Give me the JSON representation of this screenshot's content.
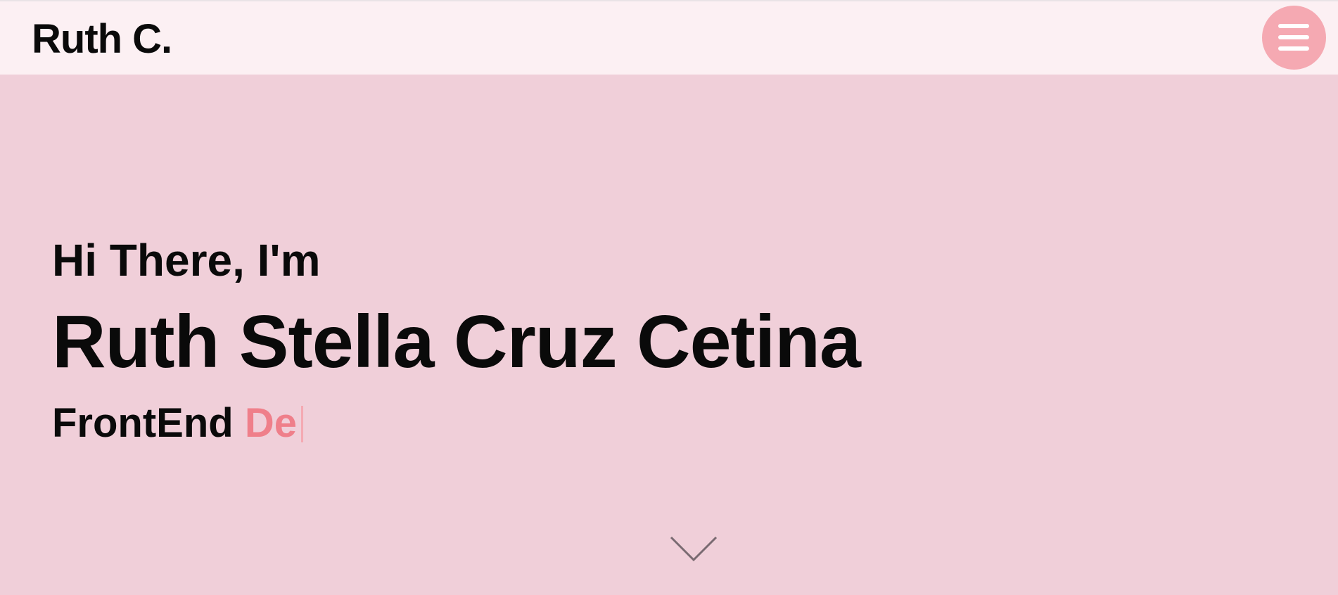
{
  "header": {
    "logo_text": "Ruth C.",
    "menu_icon": "hamburger-menu-icon"
  },
  "hero": {
    "greeting": "Hi There, I'm",
    "full_name": "Ruth Stella Cruz Cetina",
    "role_prefix": "FrontEnd",
    "role_typed": "De",
    "scroll_icon": "chevron-down-icon"
  },
  "colors": {
    "background": "#f0cfd9",
    "header_background": "#fcf0f3",
    "accent": "#f5a9b2",
    "accent_text": "#ef7f8a",
    "text": "#0a0a0a"
  }
}
